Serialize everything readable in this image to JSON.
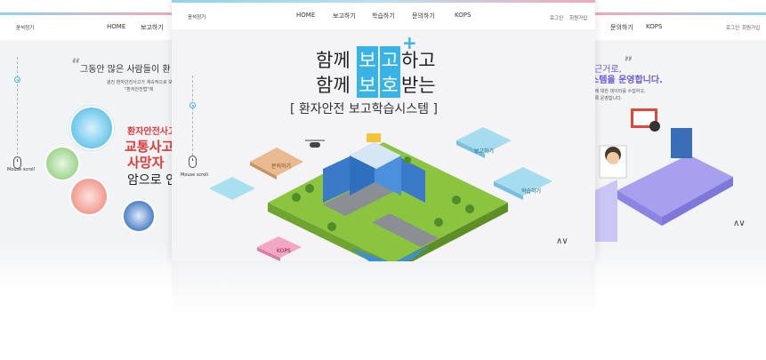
{
  "colors": {
    "accent_blue": "#39b3e6",
    "accent_red": "#e03a3a",
    "accent_purple": "#6a5bd6",
    "ground_green": "#8bc53f"
  },
  "left_panel": {
    "logo": "윤석정기",
    "nav": [
      "HOME",
      "보고하기"
    ],
    "quote": "그동안 많은 사람들이 환",
    "body_lines": [
      "광진 환자안전사고가 계속적으로 보",
      "\"환자안전법\"에"
    ],
    "red_lines": [
      "환자안전사고",
      "교통사고",
      "사망자"
    ],
    "black_line": "암으로 인",
    "mouse_label": "Mouse scroll"
  },
  "center_panel": {
    "logo": "윤석정기",
    "nav": [
      "HOME",
      "보고하기",
      "학습하기",
      "문의하기",
      "KOPS"
    ],
    "util": [
      "로그인",
      "회원가입"
    ],
    "headline1": {
      "pre": "함께",
      "box1": "보",
      "box2": "고",
      "post": "하고"
    },
    "headline2": {
      "pre": "함께",
      "box1": "보",
      "box2": "호",
      "post": "받는"
    },
    "subtitle": "[ 환자안전 보고학습시스템 ]",
    "labels": {
      "report": "보고하기",
      "learn": "학습하기",
      "inquiry": "문의하기",
      "kops": "KOPS"
    },
    "mouse_label": "Mouse scroll",
    "chevrons": "∧∨"
  },
  "right_panel": {
    "nav": [
      "문의하기",
      "KOPS"
    ],
    "util": [
      "로그인",
      "회원가입"
    ],
    "quote_line1": "근거로,",
    "quote_line2": "스템을 운영합니다.",
    "body_lines": [
      "고에 대한 데이터를 수집하고,",
      "도록 운영합니다."
    ],
    "chevrons": "∧∨"
  }
}
